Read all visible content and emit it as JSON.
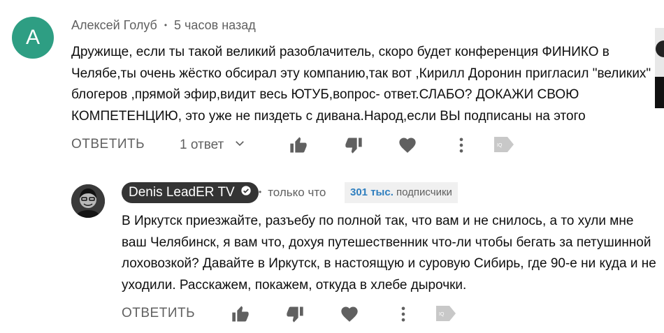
{
  "comment": {
    "avatar_letter": "A",
    "avatar_color": "#2e9e83",
    "author": "Алексей Голуб",
    "separator": "•",
    "time": "5 часов назад",
    "text": "Дружище, если ты такой великий разоблачитель, скоро будет конференция ФИНИКО в Челябе,ты очень жёстко обсирал эту компанию,так вот ,Кирилл Доронин пригласил \"великих\" блогеров ,прямой эфир,видит весь ЮТУБ,вопрос- ответ.СЛАБО? ДОКАЖИ СВОЮ КОМПЕТЕНЦИЮ, это уже не пиздеть с дивана.Народ,если ВЫ подписаны на этого",
    "reply_label": "ОТВЕТИТЬ",
    "replies_label": "1 ответ"
  },
  "reply": {
    "channel_name": "Denis LeadER TV",
    "separator": "•",
    "time": "только что",
    "subscribers_count": "301 тыс.",
    "subscribers_label": "подписчики",
    "text": "В Иркутск приезжайте, разъебу по полной так, что вам и не снилось, а то хули мне ваш Челябинск, я вам что, дохуя путешественник что-ли чтобы бегать за петушинной лоховозкой? Давайте в Иркутск, в настоящую и суровую Сибирь, где 90-е ни куда и не уходили. Расскажем, покажем, откуда в хлебе дырочки.",
    "reply_label": "ОТВЕТИТЬ"
  },
  "icons": [
    "thumb-up-icon",
    "thumb-down-icon",
    "heart-icon",
    "more-vert-icon",
    "tag-icon",
    "chevron-down-icon",
    "verified-icon"
  ],
  "colors": {
    "text": "#0f0f0f",
    "secondary": "#606060",
    "chip": "#343434",
    "subs_accent": "#2f7fbf"
  }
}
